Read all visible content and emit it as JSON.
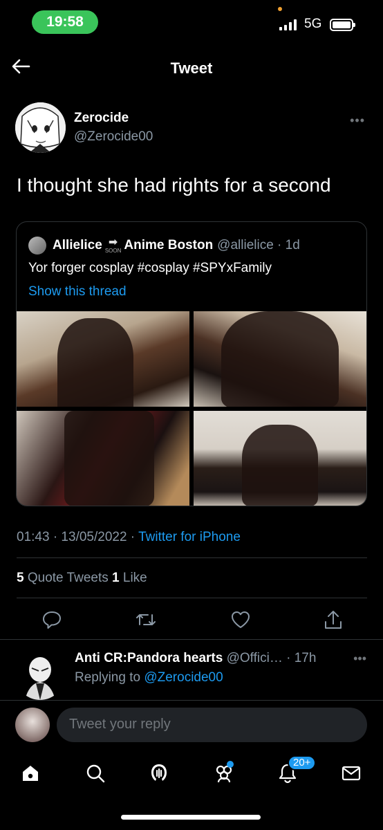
{
  "status_bar": {
    "time": "19:58",
    "network": "5G"
  },
  "nav": {
    "title": "Tweet"
  },
  "tweet": {
    "author_name": "Zerocide",
    "author_handle": "@Zerocide00",
    "text": "I thought she had rights for a second",
    "timestamp": "01:43 · 13/05/2022 · ",
    "source": "Twitter for iPhone",
    "quote_count": "5",
    "quote_label": " Quote Tweets ",
    "like_count": "1",
    "like_label": " Like"
  },
  "quoted": {
    "name_a": "Allielice",
    "soon_label": "SOON",
    "name_b": "Anime Boston",
    "handle_time": "@allielice · 1d",
    "text": "Yor forger cosplay #cosplay #SPYxFamily",
    "thread_link": "Show this thread"
  },
  "reply": {
    "name": "Anti CR:Pandora hearts",
    "handle_time": " @Offici… · 17h",
    "replying_prefix": "Replying to ",
    "replying_mention": "@Zerocide00"
  },
  "compose": {
    "placeholder": "Tweet your reply"
  },
  "tabs": {
    "notifications_badge": "20+"
  },
  "icons": [
    "back-arrow-icon",
    "more-icon",
    "reply-icon",
    "retweet-icon",
    "like-icon",
    "share-icon",
    "home-icon",
    "search-icon",
    "spaces-icon",
    "communities-icon",
    "notifications-icon",
    "messages-icon"
  ],
  "colors": {
    "accent": "#1d9bf0",
    "muted": "#8b98a5",
    "time_pill": "#3ac45a"
  }
}
